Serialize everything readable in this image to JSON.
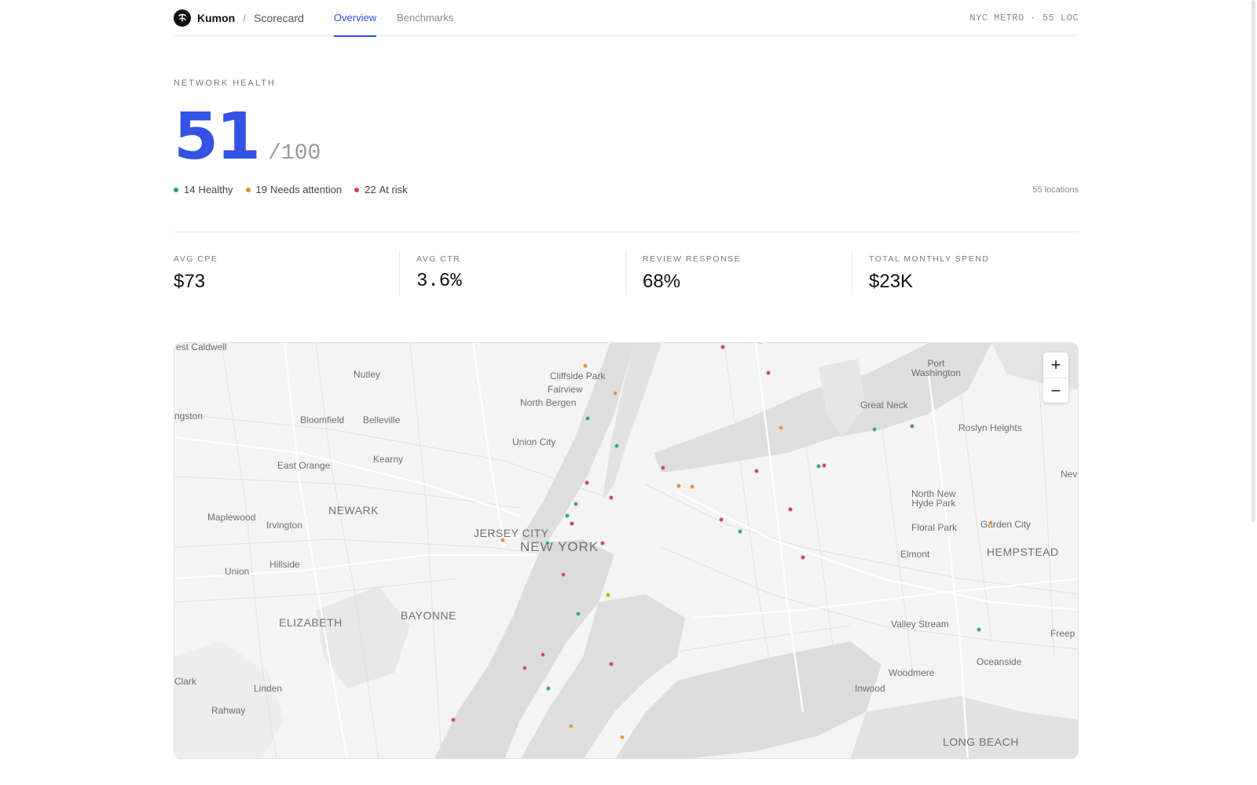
{
  "header": {
    "brand": "Kumon",
    "separator": "/",
    "page": "Scorecard",
    "tabs": [
      {
        "label": "Overview",
        "active": true
      },
      {
        "label": "Benchmarks",
        "active": false
      }
    ],
    "meta": "NYC METRO · 55 LOC"
  },
  "health": {
    "section_label": "NETWORK HEALTH",
    "score": "51",
    "score_max": "/100",
    "legend": [
      {
        "count": "14",
        "label": "Healthy",
        "color": "#3a9a7a"
      },
      {
        "count": "19",
        "label": "Needs attention",
        "color": "#d89530"
      },
      {
        "count": "22",
        "label": "At risk",
        "color": "#c84447"
      }
    ],
    "locations_label": "55 locations"
  },
  "metrics": [
    {
      "label": "AVG CPE",
      "value": "$73"
    },
    {
      "label": "AVG CTR",
      "value": "3.6%"
    },
    {
      "label": "REVIEW RESPONSE",
      "value": "68%"
    },
    {
      "label": "TOTAL MONTHLY SPEND",
      "value": "$23K"
    }
  ],
  "map": {
    "labels": {
      "west_caldwell": "est Caldwell",
      "nutley": "Nutley",
      "cliffside_park": "Cliffside Park",
      "fairview": "Fairview",
      "north_bergen": "North Bergen",
      "port_washington": "Port\nWashington",
      "livingston": "ngston",
      "bloomfield": "Bloomfield",
      "belleville": "Belleville",
      "great_neck": "Great Neck",
      "roslyn_heights": "Roslyn Heights",
      "union_city": "Union City",
      "kearny": "Kearny",
      "east_orange": "East Orange",
      "north_new_hyde_park": "North New\nHyde Park",
      "nev": "Nev",
      "newark": "NEWARK",
      "maplewood": "Maplewood",
      "irvington": "Irvington",
      "jersey_city": "JERSEY CITY",
      "new_york": "NEW YORK",
      "floral_park": "Floral Park",
      "garden_city": "Garden City",
      "elmont": "Elmont",
      "hempstead": "HEMPSTEAD",
      "hillside": "Hillside",
      "union": "Union",
      "bayonne": "BAYONNE",
      "elizabeth": "ELIZABETH",
      "valley_stream": "Valley Stream",
      "freeport": "Freep",
      "oceanside": "Oceanside",
      "woodmere": "Woodmere",
      "clark": "Clark",
      "linden": "Linden",
      "inwood": "Inwood",
      "rahway": "Rahway",
      "long_beach": "LONG BEACH"
    },
    "markers": [
      {
        "status": "at-risk"
      },
      {
        "status": "at-risk"
      },
      {
        "status": "needs-attention"
      },
      {
        "status": "at-risk"
      },
      {
        "status": "needs-attention"
      },
      {
        "status": "healthy"
      },
      {
        "status": "needs-attention"
      },
      {
        "status": "healthy"
      },
      {
        "status": "healthy"
      },
      {
        "status": "healthy"
      },
      {
        "status": "at-risk"
      },
      {
        "status": "at-risk"
      },
      {
        "status": "needs-attention"
      },
      {
        "status": "at-risk"
      },
      {
        "status": "at-risk"
      },
      {
        "status": "needs-attention"
      },
      {
        "status": "healthy"
      },
      {
        "status": "healthy"
      },
      {
        "status": "at-risk"
      },
      {
        "status": "at-risk"
      },
      {
        "status": "at-risk"
      },
      {
        "status": "healthy"
      },
      {
        "status": "needs-attention"
      },
      {
        "status": "healthy"
      },
      {
        "status": "at-risk"
      },
      {
        "status": "at-risk"
      },
      {
        "status": "at-risk"
      },
      {
        "status": "needs-attention"
      },
      {
        "status": "at-risk"
      },
      {
        "status": "needs-attention"
      },
      {
        "status": "healthy"
      },
      {
        "status": "healthy"
      },
      {
        "status": "at-risk"
      },
      {
        "status": "at-risk"
      },
      {
        "status": "at-risk"
      },
      {
        "status": "healthy"
      },
      {
        "status": "at-risk"
      },
      {
        "status": "needs-attention"
      },
      {
        "status": "needs-attention"
      },
      {
        "status": "healthy"
      }
    ],
    "status_colors": {
      "healthy": "#3a9a7a",
      "needs-attention": "#d89530",
      "at-risk": "#c84447"
    },
    "zoom_in": "+",
    "zoom_out": "−"
  }
}
